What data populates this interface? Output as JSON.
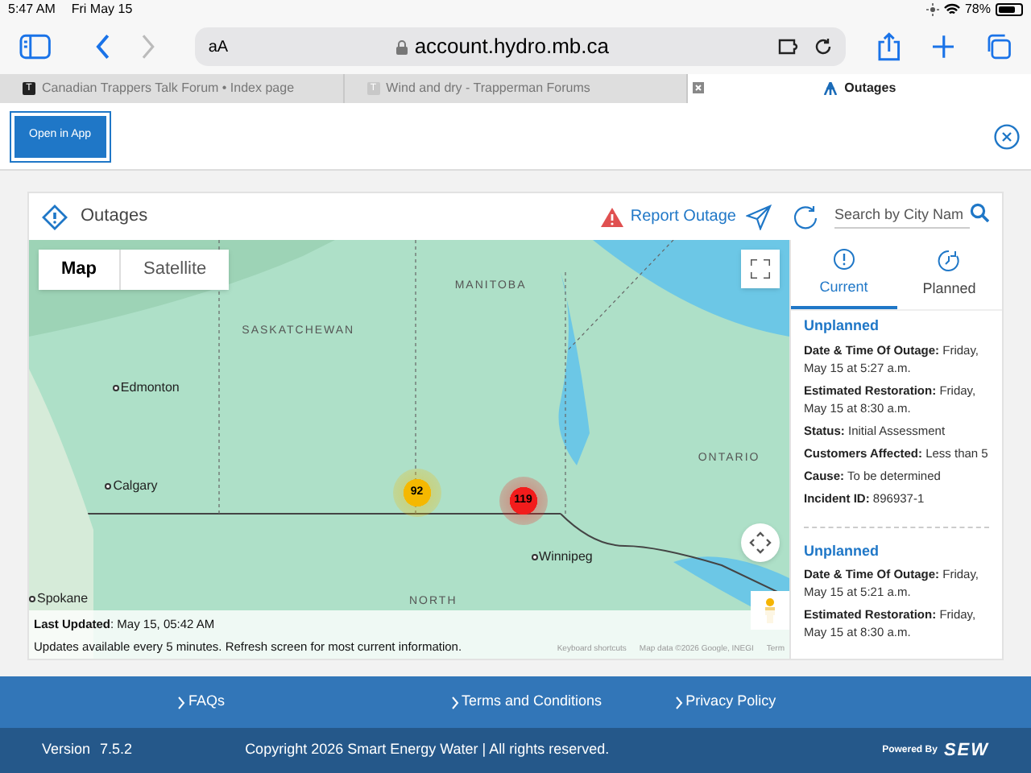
{
  "status_bar": {
    "time": "5:47 AM",
    "date": "Fri May 15",
    "battery": "78%"
  },
  "browser": {
    "text_size": "aA",
    "url": "account.hydro.mb.ca"
  },
  "tabs": [
    {
      "label": "Canadian Trappers Talk Forum • Index page",
      "favicon": "T",
      "selected": false
    },
    {
      "label": "Wind and dry - Trapperman Forums",
      "favicon": "T",
      "selected": false
    },
    {
      "label": "Outages",
      "selected": true
    }
  ],
  "banner": {
    "button": "Open in App"
  },
  "header": {
    "title": "Outages",
    "report": "Report Outage",
    "search_placeholder": "Search by City Nam"
  },
  "map": {
    "types": [
      {
        "label": "Map",
        "selected": true
      },
      {
        "label": "Satellite",
        "selected": false
      }
    ],
    "labels": [
      {
        "text": "MANITOBA",
        "kind": "region"
      },
      {
        "text": "SASKATCHEWAN",
        "kind": "region"
      },
      {
        "text": "Edmonton",
        "kind": "city"
      },
      {
        "text": "Calgary",
        "kind": "city"
      },
      {
        "text": "ONTARIO",
        "kind": "region"
      },
      {
        "text": "Winnipeg",
        "kind": "city"
      },
      {
        "text": "Spokane",
        "kind": "city"
      },
      {
        "text": "NORTH",
        "kind": "region"
      }
    ],
    "clusters": [
      {
        "count": "92",
        "color": "#f5b800"
      },
      {
        "count": "119",
        "color": "#f21c1c"
      }
    ],
    "last_updated_label": "Last Updated",
    "last_updated": ": May 15, 05:42 AM",
    "notice": "Updates available every 5 minutes. Refresh screen for most current information.",
    "attribution": [
      "Keyboard shortcuts",
      "Map data ©2026 Google, INEGI",
      "Term"
    ]
  },
  "panel": {
    "tabs": [
      {
        "label": "Current",
        "selected": true
      },
      {
        "label": "Planned",
        "selected": false
      }
    ],
    "outages": [
      {
        "type": "Unplanned",
        "fields": [
          {
            "label": "Date & Time Of Outage:",
            "value": "Friday, May 15 at 5:27 a.m."
          },
          {
            "label": "Estimated Restoration:",
            "value": "Friday, May 15 at 8:30 a.m."
          },
          {
            "label": "Status:",
            "value": "Initial Assessment"
          },
          {
            "label": "Customers Affected:",
            "value": "Less than 5"
          },
          {
            "label": "Cause:",
            "value": "To be determined"
          },
          {
            "label": "Incident ID:",
            "value": "896937-1"
          }
        ]
      },
      {
        "type": "Unplanned",
        "fields": [
          {
            "label": "Date & Time Of Outage:",
            "value": "Friday, May 15 at 5:21 a.m."
          },
          {
            "label": "Estimated Restoration:",
            "value": "Friday, May 15 at 8:30 a.m."
          }
        ]
      }
    ]
  },
  "footer": {
    "links": [
      "FAQs",
      "Terms and Conditions",
      "Privacy Policy"
    ],
    "version_label": "Version",
    "version": "7.5.2",
    "copyright": "Copyright 2026 Smart Energy Water | All rights reserved.",
    "powered_by": "Powered By",
    "logo": "SEW"
  }
}
